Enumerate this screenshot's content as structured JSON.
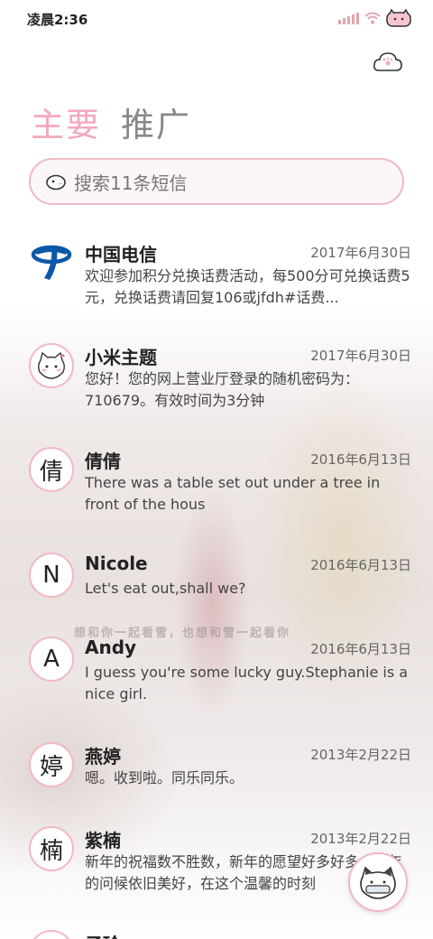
{
  "status_bar": {
    "time": "凌晨2:36"
  },
  "tabs": {
    "primary": "主要",
    "promo": "推广"
  },
  "search": {
    "placeholder": "搜索11条短信"
  },
  "background_caption": "想和你一起看雪，也想和雪一起看你",
  "messages": [
    {
      "avatar": "telecom-logo",
      "sender": "中国电信",
      "date": "2017年6月30日",
      "preview": "欢迎参加积分兑换话费活动，每500分可兑换话费5元，兑换话费请回复106或jfdh#话费..."
    },
    {
      "avatar": "cat-avatar",
      "sender": "小米主题",
      "date": "2017年6月30日",
      "preview": "您好！您的网上营业厅登录的随机密码为：710679。有效时间为3分钟"
    },
    {
      "avatar": "倩",
      "sender": "倩倩",
      "date": "2016年6月13日",
      "preview": "There was a table set out under a tree in front of the hous"
    },
    {
      "avatar": "N",
      "sender": "Nicole",
      "date": "2016年6月13日",
      "preview": "Let's eat out,shall we?"
    },
    {
      "avatar": "A",
      "sender": "Andy",
      "date": "2016年6月13日",
      "preview": "I guess you're some lucky guy.Stephanie is a nice girl."
    },
    {
      "avatar": "婷",
      "sender": "燕婷",
      "date": "2013年2月22日",
      "preview": "嗯。收到啦。同乐同乐。"
    },
    {
      "avatar": "楠",
      "sender": "紫楠",
      "date": "2013年2月22日",
      "preview": "新年的祝福数不胜数，新年的愿望好多好多，新年的问候依旧美好，在这个温馨的时刻"
    }
  ],
  "partial_next_sender": "子玲",
  "colors": {
    "accent": "#f2a9bd",
    "border": "#f2b7c6",
    "telecom_blue": "#0b57a8"
  },
  "icons": [
    "signal-icon",
    "wifi-icon",
    "cat-battery-icon",
    "theme-cloud-icon",
    "search-cat-icon",
    "compose-cat-icon"
  ]
}
